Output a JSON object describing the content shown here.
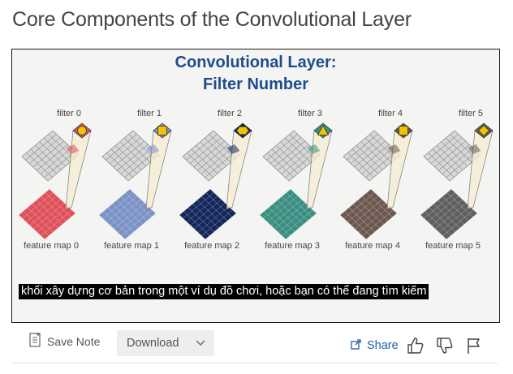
{
  "page": {
    "title": "Core Components of the Convolutional Layer"
  },
  "video": {
    "slide_title_line1": "Convolutional Layer:",
    "slide_title_line2": "Filter Number",
    "filters": [
      {
        "label": "filter 0",
        "map_label": "feature map 0",
        "color": "#e0505a",
        "kernel_color": "#e05060",
        "shape": "circle"
      },
      {
        "label": "filter 1",
        "map_label": "feature map 1",
        "color": "#7b92c4",
        "kernel_color": "#8090c8",
        "shape": "square"
      },
      {
        "label": "filter 2",
        "map_label": "feature map 2",
        "color": "#13275a",
        "kernel_color": "#13275a",
        "shape": "hexagon"
      },
      {
        "label": "filter 3",
        "map_label": "feature map 3",
        "color": "#3a8f82",
        "kernel_color": "#3a8f82",
        "shape": "triangle"
      },
      {
        "label": "filter 4",
        "map_label": "feature map 4",
        "color": "#6d5850",
        "kernel_color": "#6d5850",
        "shape": "square"
      },
      {
        "label": "filter 5",
        "map_label": "feature map 5",
        "color": "#5f5f5f",
        "kernel_color": "#5f5f5f",
        "shape": "diamond"
      }
    ],
    "subtitle": "khối xây dựng cơ bản trong một ví dụ đồ chơi, hoặc bạn có thể đang tìm kiếm"
  },
  "toolbar": {
    "save_note_label": "Save Note",
    "download_label": "Download",
    "share_label": "Share"
  },
  "colors": {
    "slide_title": "#1f4d8a",
    "share_link": "#1f5fa8",
    "shape_fill": "#f2c200"
  }
}
